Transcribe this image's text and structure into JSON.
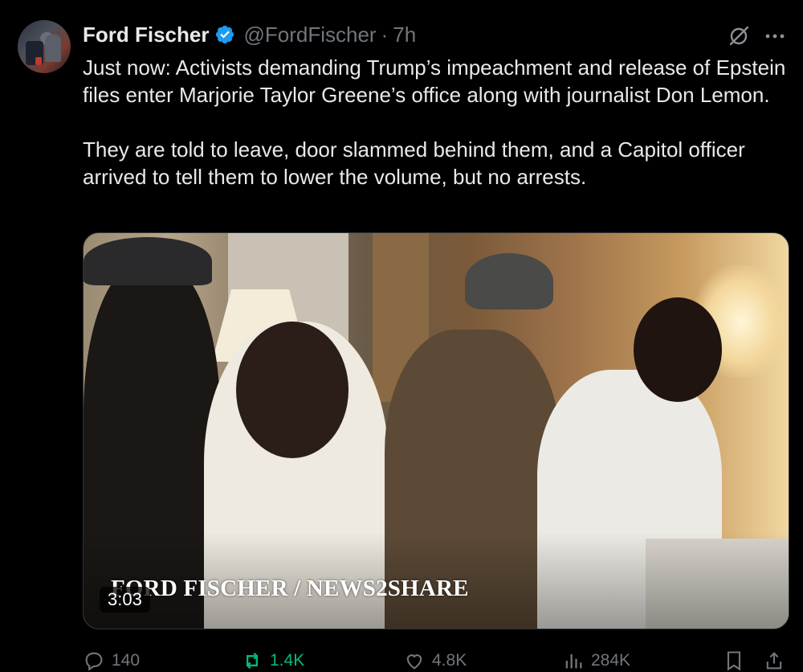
{
  "tweet": {
    "author_name": "Ford Fischer",
    "handle": "@FordFischer",
    "separator": "·",
    "time": "7h",
    "text": "Just now: Activists demanding Trump’s impeachment and release of Epstein files enter Marjorie Taylor Greene’s office along with journalist Don Lemon.\n\nThey are told to leave, door slammed behind them, and a Capitol officer arrived to tell them to lower the volume, but no arrests."
  },
  "media": {
    "watermark": "FORD FISCHER / NEWS2SHARE",
    "duration": "3:03"
  },
  "actions": {
    "replies": "140",
    "reposts": "1.4K",
    "likes": "4.8K",
    "views": "284K"
  },
  "colors": {
    "background": "#000000",
    "text": "#e7e9ea",
    "muted": "#71767b",
    "verified": "#1d9bf0",
    "repost_active": "#00ba7c"
  },
  "icons": [
    "verified-badge-icon",
    "grok-icon",
    "more-icon",
    "reply-icon",
    "repost-icon",
    "like-icon",
    "views-icon",
    "bookmark-icon",
    "share-icon"
  ]
}
